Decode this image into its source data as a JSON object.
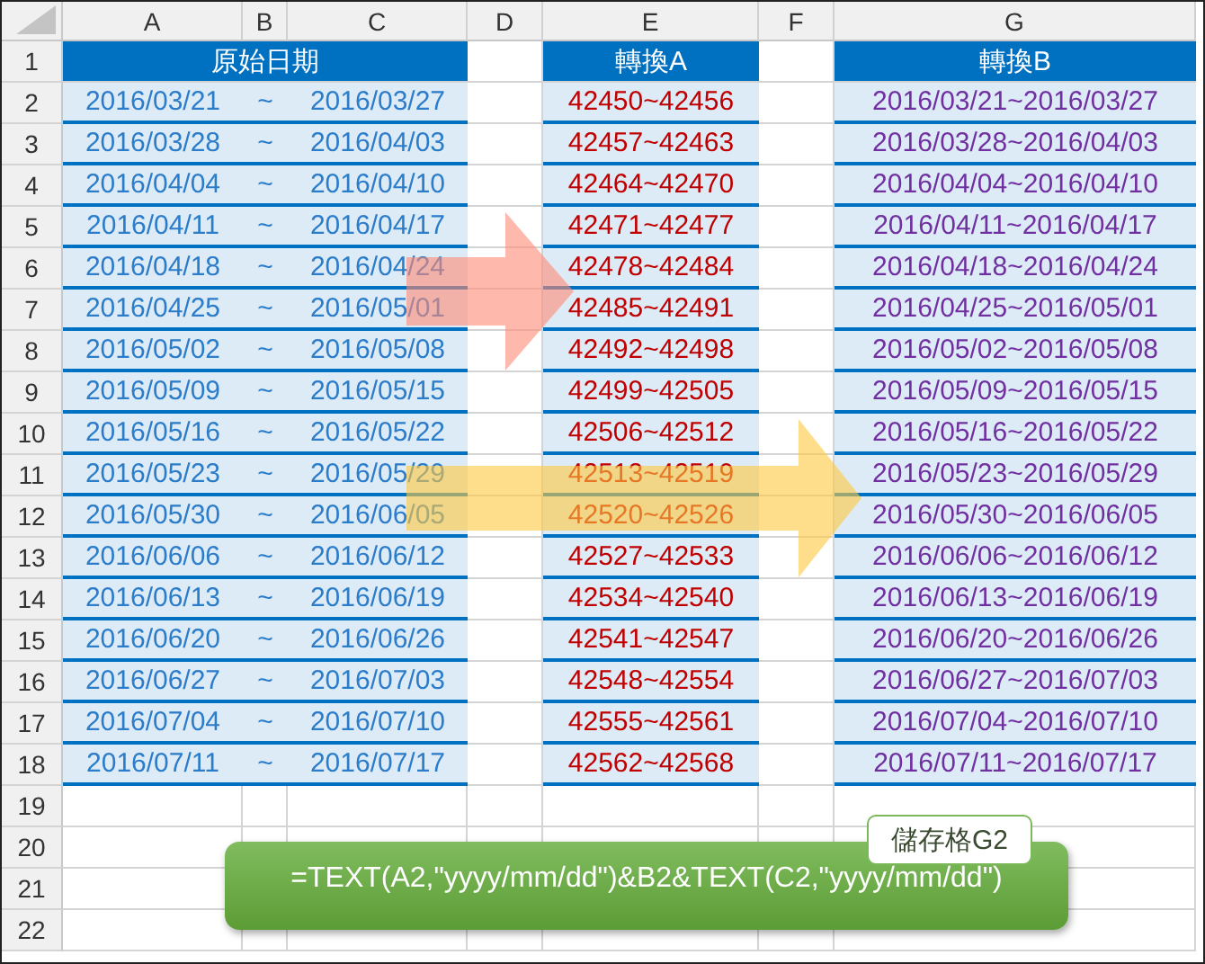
{
  "columns": [
    "A",
    "B",
    "C",
    "D",
    "E",
    "F",
    "G"
  ],
  "header": {
    "row": "1",
    "source": "原始日期",
    "convert_a": "轉換A",
    "convert_b": "轉換B"
  },
  "rows": [
    {
      "row": "2",
      "start": "2016/03/21",
      "sep": "~",
      "end": "2016/03/27",
      "convert_a": "42450~42456",
      "convert_b": "2016/03/21~2016/03/27"
    },
    {
      "row": "3",
      "start": "2016/03/28",
      "sep": "~",
      "end": "2016/04/03",
      "convert_a": "42457~42463",
      "convert_b": "2016/03/28~2016/04/03"
    },
    {
      "row": "4",
      "start": "2016/04/04",
      "sep": "~",
      "end": "2016/04/10",
      "convert_a": "42464~42470",
      "convert_b": "2016/04/04~2016/04/10"
    },
    {
      "row": "5",
      "start": "2016/04/11",
      "sep": "~",
      "end": "2016/04/17",
      "convert_a": "42471~42477",
      "convert_b": "2016/04/11~2016/04/17"
    },
    {
      "row": "6",
      "start": "2016/04/18",
      "sep": "~",
      "end": "2016/04/24",
      "convert_a": "42478~42484",
      "convert_b": "2016/04/18~2016/04/24"
    },
    {
      "row": "7",
      "start": "2016/04/25",
      "sep": "~",
      "end": "2016/05/01",
      "convert_a": "42485~42491",
      "convert_b": "2016/04/25~2016/05/01"
    },
    {
      "row": "8",
      "start": "2016/05/02",
      "sep": "~",
      "end": "2016/05/08",
      "convert_a": "42492~42498",
      "convert_b": "2016/05/02~2016/05/08"
    },
    {
      "row": "9",
      "start": "2016/05/09",
      "sep": "~",
      "end": "2016/05/15",
      "convert_a": "42499~42505",
      "convert_b": "2016/05/09~2016/05/15"
    },
    {
      "row": "10",
      "start": "2016/05/16",
      "sep": "~",
      "end": "2016/05/22",
      "convert_a": "42506~42512",
      "convert_b": "2016/05/16~2016/05/22"
    },
    {
      "row": "11",
      "start": "2016/05/23",
      "sep": "~",
      "end": "2016/05/29",
      "convert_a": "42513~42519",
      "convert_b": "2016/05/23~2016/05/29"
    },
    {
      "row": "12",
      "start": "2016/05/30",
      "sep": "~",
      "end": "2016/06/05",
      "convert_a": "42520~42526",
      "convert_b": "2016/05/30~2016/06/05"
    },
    {
      "row": "13",
      "start": "2016/06/06",
      "sep": "~",
      "end": "2016/06/12",
      "convert_a": "42527~42533",
      "convert_b": "2016/06/06~2016/06/12"
    },
    {
      "row": "14",
      "start": "2016/06/13",
      "sep": "~",
      "end": "2016/06/19",
      "convert_a": "42534~42540",
      "convert_b": "2016/06/13~2016/06/19"
    },
    {
      "row": "15",
      "start": "2016/06/20",
      "sep": "~",
      "end": "2016/06/26",
      "convert_a": "42541~42547",
      "convert_b": "2016/06/20~2016/06/26"
    },
    {
      "row": "16",
      "start": "2016/06/27",
      "sep": "~",
      "end": "2016/07/03",
      "convert_a": "42548~42554",
      "convert_b": "2016/06/27~2016/07/03"
    },
    {
      "row": "17",
      "start": "2016/07/04",
      "sep": "~",
      "end": "2016/07/10",
      "convert_a": "42555~42561",
      "convert_b": "2016/07/04~2016/07/10"
    },
    {
      "row": "18",
      "start": "2016/07/11",
      "sep": "~",
      "end": "2016/07/17",
      "convert_a": "42562~42568",
      "convert_b": "2016/07/11~2016/07/17"
    }
  ],
  "empty_rows": [
    "19",
    "20",
    "21",
    "22"
  ],
  "callout": {
    "label": "儲存格G2",
    "formula": "=TEXT(A2,\"yyyy/mm/dd\")&B2&TEXT(C2,\"yyyy/mm/dd\")"
  }
}
